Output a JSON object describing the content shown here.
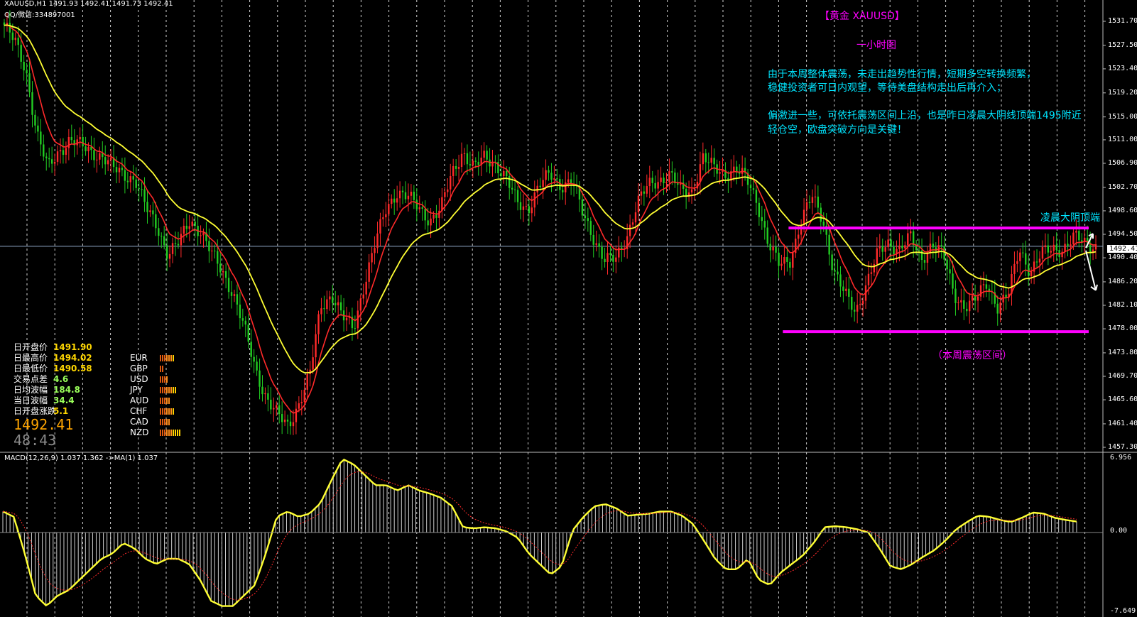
{
  "header": {
    "symbol_line": "XAUUSD,H1  1491.93 1492.41 1491.73 1492.41",
    "contact_line": "QQ/微信:334897001"
  },
  "annotations": {
    "title": "【黄金 XAUUSD】",
    "subtitle": "一小时图",
    "para1_line1": "由于本周整体震荡，未走出趋势性行情，短期多空转换频繁，",
    "para1_line2": "稳健投资者可日内观望，等待美盘结构走出后再介入；",
    "para2_line1": "偏激进一些，可依托震荡区间上沿，也是昨日凌晨大阴线顶端1495附近",
    "para2_line2": "轻仓空，欧盘突破方向是关键！",
    "top_label": "凌晨大阴顶端",
    "range_label": "（本周震荡区间）"
  },
  "stats": [
    {
      "label": "日开盘价",
      "value": "1491.90"
    },
    {
      "label": "日最高价",
      "value": "1494.02"
    },
    {
      "label": "日最低价",
      "value": "1490.58"
    },
    {
      "label": "交易点差",
      "value": "4.6"
    },
    {
      "label": "日均波幅",
      "value": "184.8"
    },
    {
      "label": "当日波幅",
      "value": "34.4"
    },
    {
      "label": "日开盘涨跌",
      "value": "5.1"
    }
  ],
  "current_price": "1492.41",
  "timer": "48:43",
  "currencies": [
    {
      "name": "EUR",
      "bars": 7
    },
    {
      "name": "GBP",
      "bars": 2
    },
    {
      "name": "USD",
      "bars": 4
    },
    {
      "name": "JPY",
      "bars": 8
    },
    {
      "name": "AUD",
      "bars": 5
    },
    {
      "name": "CHF",
      "bars": 7
    },
    {
      "name": "CAD",
      "bars": 5
    },
    {
      "name": "NZD",
      "bars": 10
    }
  ],
  "price_axis": [
    "1531.70",
    "1527.50",
    "1523.40",
    "1519.20",
    "1515.00",
    "1511.00",
    "1506.90",
    "1502.70",
    "1498.60",
    "1494.50",
    "1490.40",
    "1486.20",
    "1482.10",
    "1478.00",
    "1473.80",
    "1469.70",
    "1465.60",
    "1461.40",
    "1457.30"
  ],
  "price_tag": "1492.41",
  "macd": {
    "label": "MACD(12,26,9) 1.037 1.362  ->MA(1) 1.037",
    "axis_top": "6.956",
    "axis_zero": "0.00",
    "axis_bottom": "-7.649"
  },
  "colors": {
    "up_candle": "#ff2a2a",
    "down_candle": "#22cc22",
    "ma_fast": "#ff2a2a",
    "ma_slow": "#ffff33",
    "range_lines": "#ff00ff",
    "annotation_text": "#00e5ff",
    "title_text": "#ff00ff"
  },
  "chart_data": {
    "type": "candlestick",
    "symbol": "XAUUSD",
    "timeframe": "H1",
    "ylim": [
      1457.3,
      1531.7
    ],
    "range_high": 1495.6,
    "range_low": 1477.5,
    "close_path": [
      1531,
      1528,
      1523,
      1512,
      1506,
      1509,
      1511,
      1510,
      1509,
      1508,
      1506,
      1505,
      1504,
      1499,
      1496,
      1491,
      1493,
      1497,
      1495,
      1491,
      1488,
      1484,
      1478,
      1471,
      1466,
      1463,
      1461,
      1465,
      1470,
      1482,
      1484,
      1480,
      1478,
      1486,
      1493,
      1499,
      1502,
      1501,
      1499,
      1497,
      1499,
      1505,
      1509,
      1506,
      1508,
      1507,
      1504,
      1500,
      1499,
      1503,
      1505,
      1503,
      1504,
      1498,
      1494,
      1490,
      1490,
      1494,
      1500,
      1503,
      1504,
      1505,
      1502,
      1502,
      1508,
      1506,
      1505,
      1506,
      1504,
      1500,
      1493,
      1489,
      1490,
      1497,
      1501,
      1497,
      1488,
      1484,
      1481,
      1486,
      1491,
      1493,
      1492,
      1494,
      1490,
      1493,
      1491,
      1484,
      1482,
      1483,
      1486,
      1482,
      1484,
      1492,
      1488,
      1491,
      1492,
      1492,
      1494,
      1493,
      1492.41
    ],
    "macd_path": [
      2,
      1.5,
      -2,
      -6,
      -7,
      -6,
      -5.5,
      -4.5,
      -3.5,
      -2.5,
      -2,
      -1,
      -1.5,
      -2.5,
      -3,
      -2.5,
      -2.5,
      -3,
      -4.5,
      -6.5,
      -7,
      -7,
      -6,
      -5,
      -2,
      1.5,
      2,
      1.5,
      1.8,
      2.8,
      5,
      7,
      6.5,
      5.5,
      4.5,
      4.5,
      4,
      4.5,
      4,
      3.7,
      3.3,
      2.5,
      0.5,
      0.4,
      0.5,
      0.4,
      0.1,
      -0.5,
      -2,
      -3,
      -4,
      -3.2,
      0.2,
      1.5,
      2.5,
      2.7,
      2.3,
      1.6,
      1.7,
      1.8,
      2.0,
      2.0,
      1.6,
      0.8,
      -0.8,
      -2.5,
      -3.5,
      -3.5,
      -2.5,
      -4.5,
      -5,
      -3.8,
      -3,
      -2.2,
      -1,
      0.5,
      0.6,
      0.5,
      0.3,
      0,
      -1.5,
      -3.2,
      -3.5,
      -3,
      -2.3,
      -1.7,
      -0.8,
      0.3,
      1,
      1.6,
      1.5,
      1.2,
      1.0,
      1.4,
      1.9,
      1.8,
      1.4,
      1.2,
      1.04
    ]
  }
}
